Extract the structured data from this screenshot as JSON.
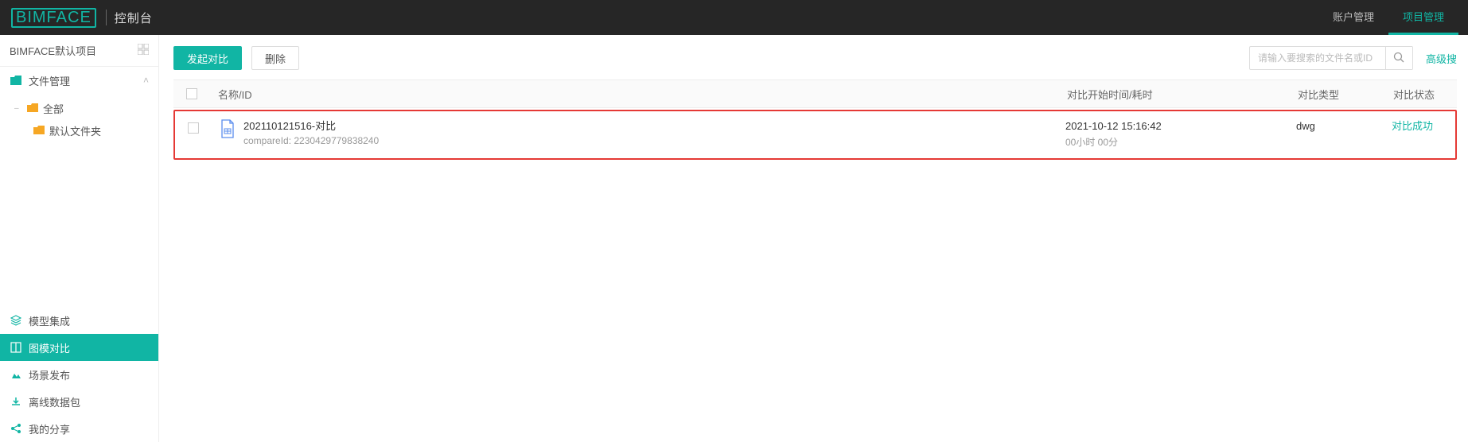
{
  "header": {
    "logo_text": "BIMFACE",
    "console_label": "控制台",
    "nav": {
      "account": "账户管理",
      "project": "项目管理"
    }
  },
  "sidebar": {
    "project_name": "BIMFACE默认项目",
    "file_mgmt": "文件管理",
    "tree": {
      "root": "全部",
      "child": "默认文件夹"
    },
    "menu": {
      "model_integration": "模型集成",
      "compare": "图模对比",
      "scene_publish": "场景发布",
      "offline_pkg": "离线数据包",
      "my_share": "我的分享"
    }
  },
  "toolbar": {
    "compare_btn": "发起对比",
    "delete_btn": "删除",
    "search_placeholder": "请输入要搜索的文件名或ID",
    "adv_search": "高级搜"
  },
  "table": {
    "headers": {
      "name": "名称/ID",
      "start": "对比开始时间/耗时",
      "type": "对比类型",
      "status": "对比状态"
    },
    "rows": [
      {
        "title": "202110121516-对比",
        "compare_id_label": "compareId: 2230429779838240",
        "start_time": "2021-10-12 15:16:42",
        "duration": "00小时 00分",
        "type": "dwg",
        "status": "对比成功"
      }
    ]
  }
}
